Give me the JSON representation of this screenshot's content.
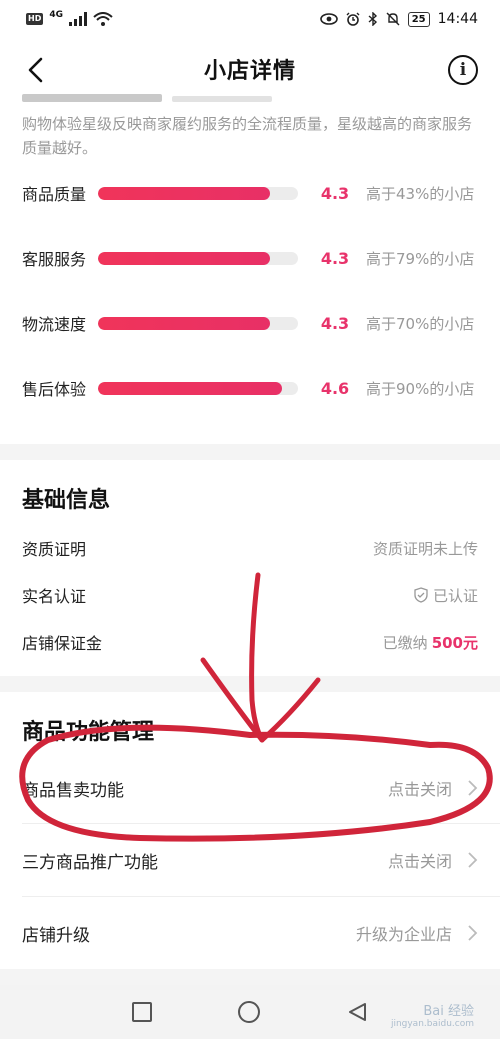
{
  "status_bar": {
    "hd": "HD",
    "network": "4G",
    "battery": "25",
    "time": "14:44"
  },
  "nav": {
    "title": "小店详情",
    "info_glyph": "i"
  },
  "description": "购物体验星级反映商家履约服务的全流程质量，星级越高的商家服务质量越好。",
  "ratings": [
    {
      "label": "商品质量",
      "score": "4.3",
      "compare": "高于43%的小店",
      "fill_fraction": 0.86
    },
    {
      "label": "客服服务",
      "score": "4.3",
      "compare": "高于79%的小店",
      "fill_fraction": 0.86
    },
    {
      "label": "物流速度",
      "score": "4.3",
      "compare": "高于70%的小店",
      "fill_fraction": 0.86
    },
    {
      "label": "售后体验",
      "score": "4.6",
      "compare": "高于90%的小店",
      "fill_fraction": 0.92
    }
  ],
  "basic_info": {
    "title": "基础信息",
    "rows": [
      {
        "label": "资质证明",
        "value": "资质证明未上传"
      },
      {
        "label": "实名认证",
        "value": "已认证"
      },
      {
        "label": "店铺保证金",
        "value_prefix": "已缴纳",
        "value_amount": "500元"
      }
    ]
  },
  "functions": {
    "title": "商品功能管理",
    "rows": [
      {
        "label": "商品售卖功能",
        "action": "点击关闭"
      },
      {
        "label": "三方商品推广功能",
        "action": "点击关闭"
      },
      {
        "label": "店铺升级",
        "action": "升级为企业店"
      }
    ]
  },
  "watermark": {
    "main": "Bai 经验",
    "sub": "jingyan.baidu.com"
  },
  "colors": {
    "accent": "#e8336b",
    "annotation": "#d0253a"
  }
}
